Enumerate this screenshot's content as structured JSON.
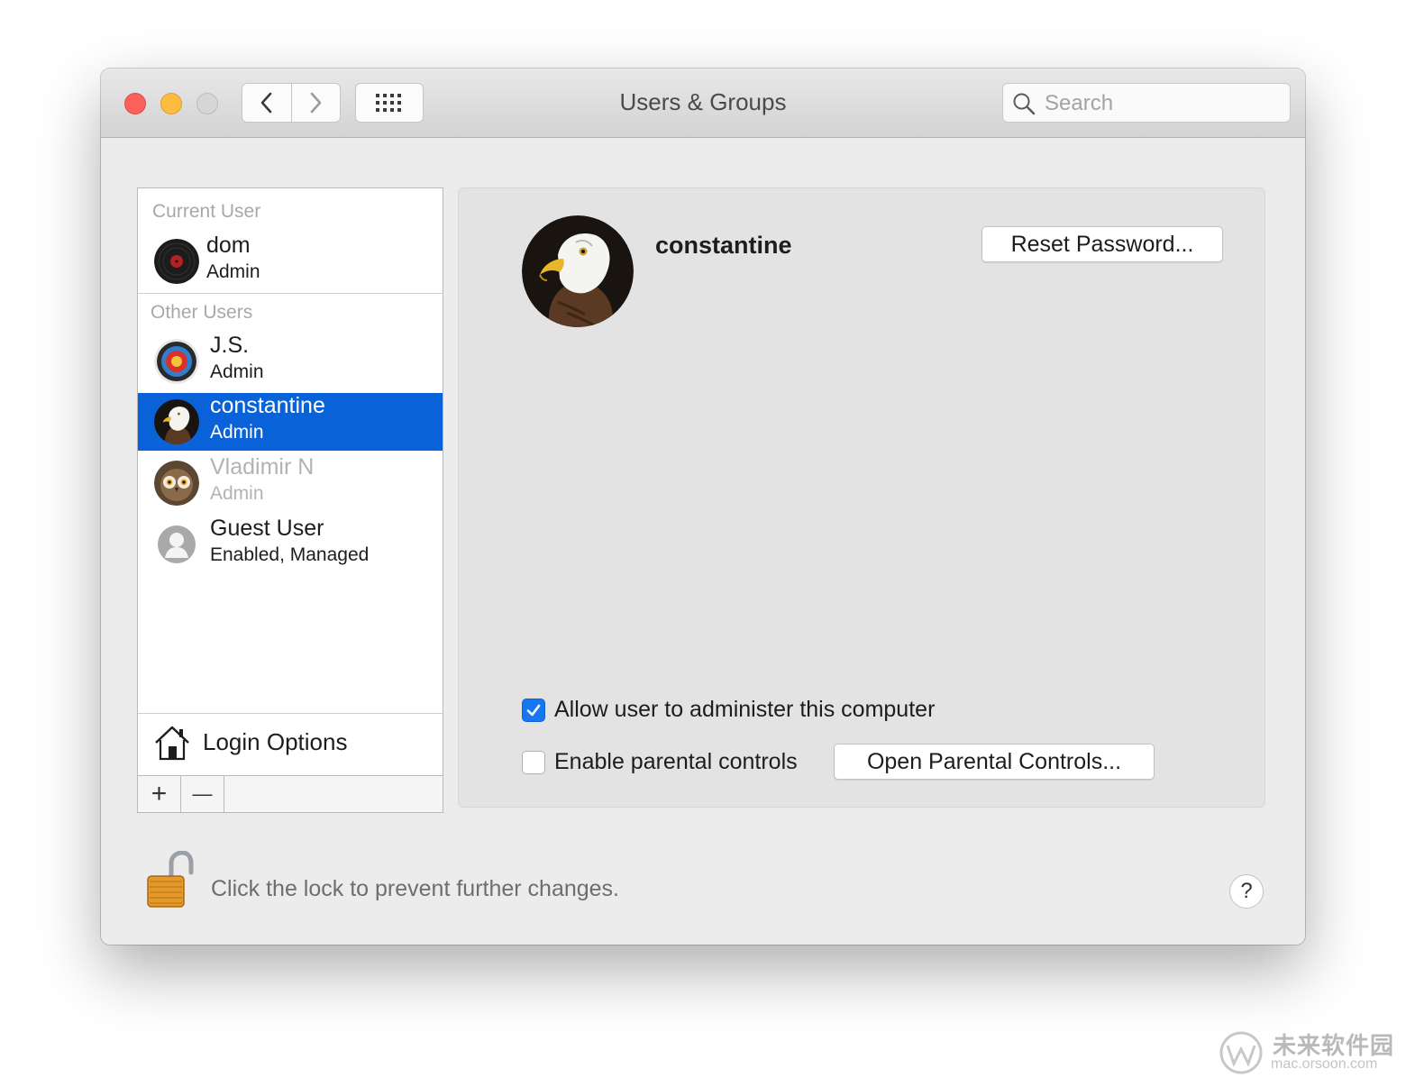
{
  "window": {
    "title": "Users & Groups",
    "search_placeholder": "Search"
  },
  "sidebar": {
    "current_user_header": "Current User",
    "other_users_header": "Other Users",
    "current_user": {
      "name": "dom",
      "role": "Admin",
      "avatar": "vinyl-record"
    },
    "users": [
      {
        "name": "J.S.",
        "role": "Admin",
        "avatar": "archery-target",
        "state": "normal"
      },
      {
        "name": "constantine",
        "role": "Admin",
        "avatar": "bald-eagle",
        "state": "selected"
      },
      {
        "name": "Vladimir N",
        "role": "Admin",
        "avatar": "owl",
        "state": "dimmed"
      },
      {
        "name": "Guest User",
        "role": "Enabled, Managed",
        "avatar": "generic-person",
        "state": "normal"
      }
    ],
    "login_options_label": "Login Options",
    "add_label": "+",
    "remove_label": "—"
  },
  "detail": {
    "user_name": "constantine",
    "reset_password_label": "Reset Password...",
    "allow_admin_label": "Allow user to administer this computer",
    "allow_admin_checked": true,
    "parental_controls_label": "Enable parental controls",
    "parental_controls_checked": false,
    "open_parental_label": "Open Parental Controls..."
  },
  "footer": {
    "lock_text": "Click the lock to prevent further changes.",
    "help_label": "?"
  },
  "watermark": {
    "brand": "未来软件园",
    "url": "mac.orsoon.com"
  },
  "colors": {
    "selection": "#0a62d9",
    "checkbox_on": "#1677f2",
    "close": "#fc605c",
    "minimize": "#fdbc40"
  }
}
